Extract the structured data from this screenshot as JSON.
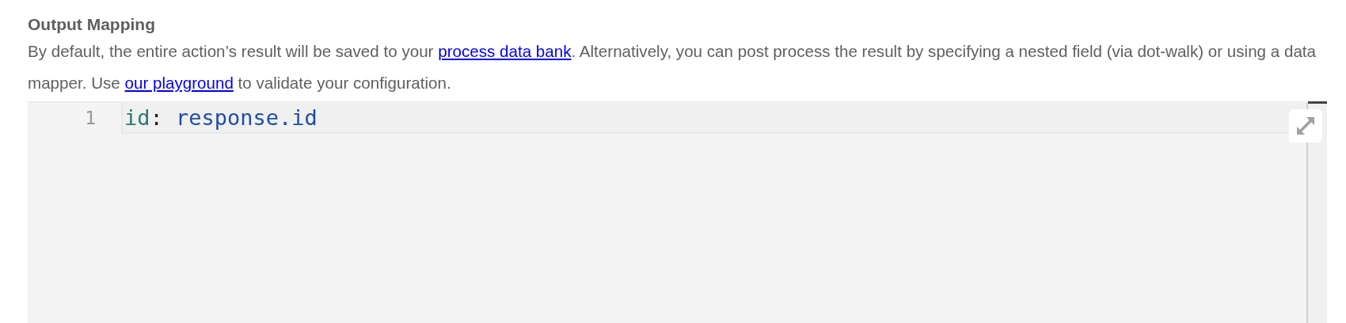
{
  "section": {
    "title": "Output Mapping",
    "description": [
      {
        "kind": "text",
        "text": "By default, the entire action’s result will be saved to your "
      },
      {
        "kind": "link",
        "text": "process data bank"
      },
      {
        "kind": "text",
        "text": ". Alternatively, you can post process the result by specifying a nested field (via dot-walk) or using a data mapper. Use "
      },
      {
        "kind": "link",
        "text": "our playground"
      },
      {
        "kind": "text",
        "text": " to validate your configuration."
      }
    ]
  },
  "editor": {
    "lines": [
      {
        "number": "1",
        "active": true,
        "tokens": [
          {
            "kind": "key",
            "text": "id"
          },
          {
            "kind": "punct",
            "text": ":"
          },
          {
            "kind": "value",
            "text": " response.id"
          }
        ]
      }
    ]
  }
}
